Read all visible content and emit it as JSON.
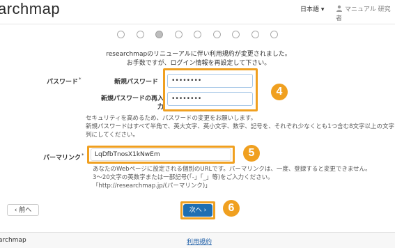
{
  "header": {
    "logo": "archmap",
    "language": "日本語 ▾",
    "user": "マニュアル 研究者"
  },
  "steps": {
    "count": 9,
    "active_index": 2
  },
  "notice": {
    "line1": "researchmapのリニューアルに伴い利用規約が変更されました。",
    "line2": "お手数ですが、ログイン情報を再設定して下さい。"
  },
  "password": {
    "label": "パスワード",
    "required_mark": "*",
    "new_label": "新規パスワード",
    "new_value": "••••••••",
    "confirm_label_line1": "新規パスワードの再入",
    "confirm_label_line2": "力",
    "confirm_value": "••••••••",
    "badge": "4",
    "help_line1": "セキュリティを高めるため、パスワードの変更をお願いします。",
    "help_line2": "新規パスワードはすべて半角で、英大文字、英小文字、数字、記号を、それぞれ少なくとも1つ含む8文字以上の文字",
    "help_line3": "列にしてください。"
  },
  "permalink": {
    "label": "パーマリンク",
    "required_mark": "*",
    "value": "LqDfbTnosX1kNwEm",
    "badge": "5",
    "help_line1": "あなたのWebページに設定される個別のURLです。パーマリンクは、一度、登録すると変更できません。",
    "help_line2": "3～20文字の英数字または一部記号(「-」「_」等)をご入力ください。",
    "help_line3": "「http://researchmap.jp/(パーマリンク)」"
  },
  "buttons": {
    "back": "‹ 前へ",
    "next": "次へ ›",
    "badge": "6"
  },
  "footer": {
    "left": "archmap",
    "terms": "利用規約"
  },
  "colors": {
    "accent": "#f0a020",
    "primary": "#1f6fb2"
  }
}
